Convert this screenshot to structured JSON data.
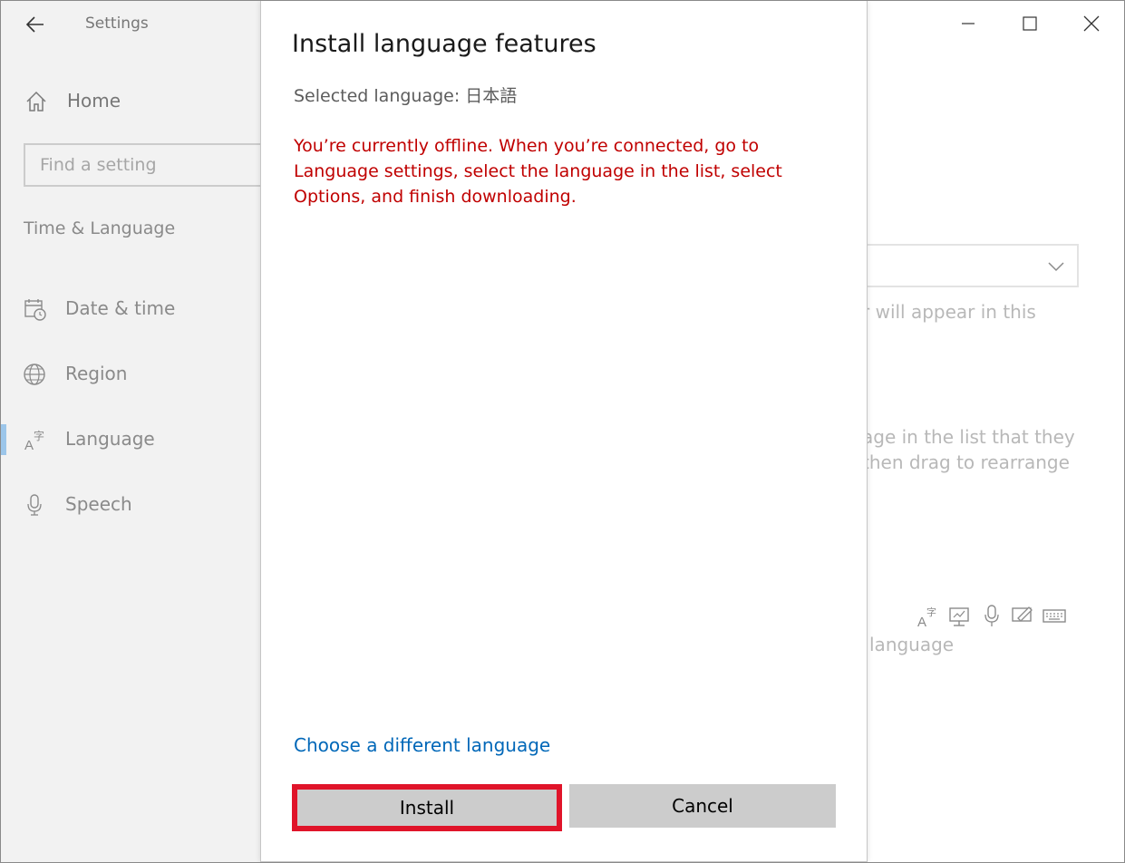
{
  "window": {
    "title": "Settings",
    "controls": {
      "minimize_icon": "minimize-icon",
      "maximize_icon": "maximize-icon",
      "close_icon": "close-icon"
    }
  },
  "sidebar": {
    "home_label": "Home",
    "search": {
      "placeholder": "Find a setting",
      "value": ""
    },
    "section_title": "Time & Language",
    "items": [
      {
        "label": "Date & time",
        "icon": "calendar-clock-icon",
        "selected": false
      },
      {
        "label": "Region",
        "icon": "globe-icon",
        "selected": false
      },
      {
        "label": "Language",
        "icon": "language-icon",
        "selected": true
      },
      {
        "label": "Speech",
        "icon": "microphone-icon",
        "selected": false
      }
    ]
  },
  "background": {
    "text_1": "r will appear in this",
    "text_2": "age in the list that they",
    "text_3": "then drag to rearrange",
    "text_4": "language",
    "feature_icons": [
      "language-icon",
      "display-icon",
      "microphone-icon",
      "handwriting-icon",
      "keyboard-icon"
    ]
  },
  "dialog": {
    "title": "Install language features",
    "selected_language": "Selected language: 日本語",
    "error_message": "You’re currently offline. When you’re connected, go to Language settings, select the language in the list, select Options, and finish downloading.",
    "link_label": "Choose a different language",
    "install_label": "Install",
    "cancel_label": "Cancel"
  },
  "colors": {
    "error": "#c00000",
    "link": "#0067b8",
    "highlight_border": "#e0142a",
    "button_bg": "#cccccc",
    "sidebar_bg": "#f2f2f2",
    "selected_indicator": "#9cc6ea"
  }
}
